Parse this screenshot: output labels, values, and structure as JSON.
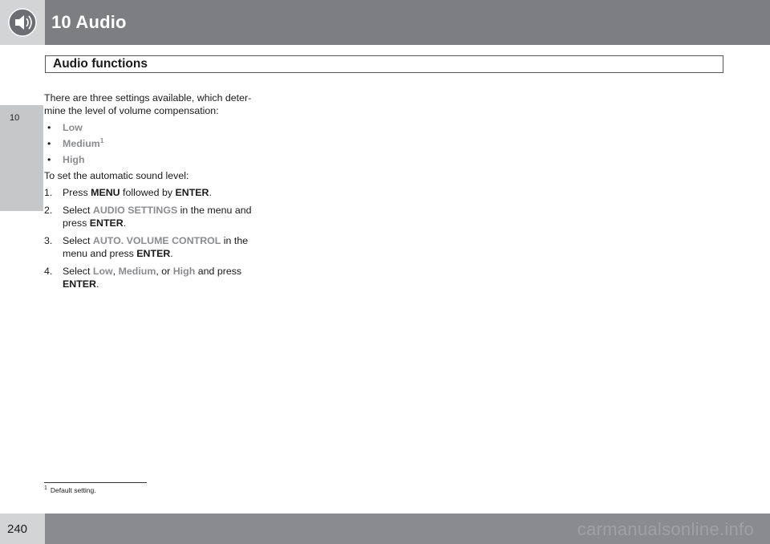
{
  "header": {
    "chapter_title": "10 Audio"
  },
  "section": {
    "title": "Audio functions"
  },
  "sidebar": {
    "tab_number": "10"
  },
  "content": {
    "intro": "There are three settings available, which deter- mine the level of volume compensation:",
    "levels": [
      {
        "label": "Low",
        "sup": ""
      },
      {
        "label": "Medium",
        "sup": "1"
      },
      {
        "label": "High",
        "sup": ""
      }
    ],
    "steps_intro": "To set the automatic sound level:",
    "steps": {
      "s1": {
        "num": "1.",
        "a": "Press ",
        "b": "MENU",
        "c": " followed by ",
        "d": "ENTER",
        "e": "."
      },
      "s2": {
        "num": "2.",
        "a": "Select ",
        "g": "AUDIO SETTINGS",
        "c": " in the menu and press ",
        "d": "ENTER",
        "e": "."
      },
      "s3": {
        "num": "3.",
        "a": "Select ",
        "g": "AUTO. VOLUME CONTROL",
        "c": " in the menu and press ",
        "d": "ENTER",
        "e": "."
      },
      "s4": {
        "num": "4.",
        "a": "Select ",
        "g1": "Low",
        "sep1": ", ",
        "g2": "Medium",
        "sep2": ", or ",
        "g3": "High",
        "c": " and press ",
        "d": "ENTER",
        "e": "."
      }
    },
    "bullet_glyph": "•"
  },
  "footnote": {
    "mark": "1",
    "text": "Default setting."
  },
  "footer": {
    "page_number": "240",
    "watermark": "carmanualsonline.info"
  },
  "colors": {
    "header_bg": "#7d7e82",
    "highlight_text": "#8b8c8f",
    "tab_bg": "#c6c7c9"
  },
  "icons": {
    "chapter_icon": "speaker-icon"
  }
}
